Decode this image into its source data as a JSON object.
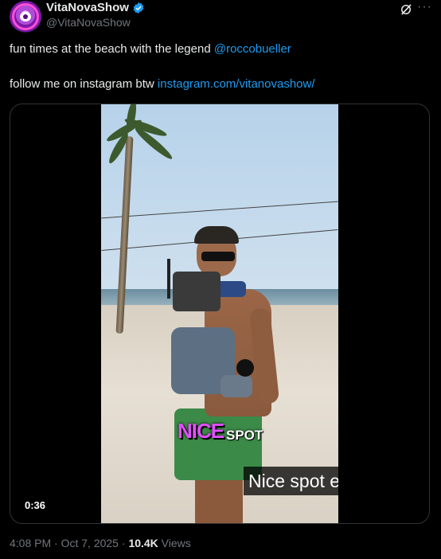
{
  "author": {
    "display_name": "VitaNovaShow",
    "handle": "@VitaNovaShow",
    "verified_color": "#1d9bf0"
  },
  "tweet": {
    "line1_text": "fun times at the beach with the legend ",
    "line1_mention": "@roccobueller",
    "line2_text": "follow me on instagram btw ",
    "line2_link": "instagram.com/vitanovashow/",
    "link_color": "#1d9bf0"
  },
  "video": {
    "caption_emphasis": "NICE",
    "caption_word": "SPOT",
    "subtitle": "Nice spot eh?",
    "duration": "0:36"
  },
  "footer": {
    "time": "4:08 PM",
    "separator": " · ",
    "date": "Oct 7, 2025",
    "views_count": "10.4K",
    "views_label": " Views"
  },
  "icons": {
    "verified": "verified-badge-icon",
    "grok": "grok-icon",
    "more": "more-options-icon"
  }
}
